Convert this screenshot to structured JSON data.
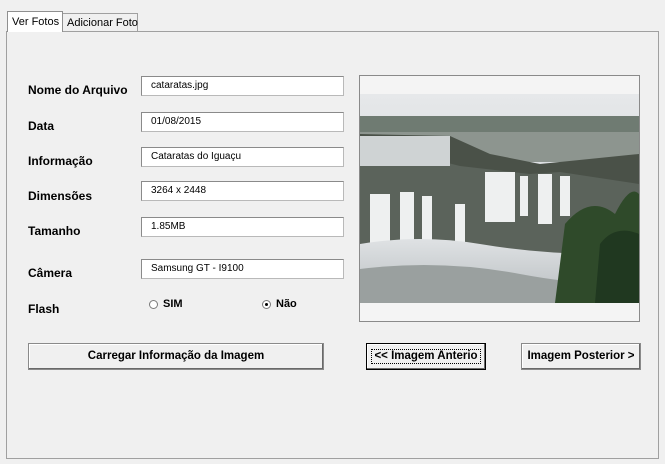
{
  "tabs": [
    {
      "label": "Ver Fotos",
      "active": true
    },
    {
      "label": "Adicionar Foto",
      "active": false
    }
  ],
  "form": {
    "nome_label": "Nome do Arquivo",
    "nome_value": "cataratas.jpg",
    "data_label": "Data",
    "data_value": "01/08/2015",
    "info_label": "Informação",
    "info_value": "Cataratas do Iguaçu",
    "dim_label": "Dimensões",
    "dim_value": "3264 x 2448",
    "tam_label": "Tamanho",
    "tam_value": "1.85MB",
    "cam_label": "Câmera",
    "cam_value": "Samsung GT - I9100",
    "flash_label": "Flash",
    "flash_options": [
      "SIM",
      "Não"
    ],
    "flash_selected": "Não"
  },
  "buttons": {
    "load": "Carregar Informação da Imagem",
    "prev": "<< Imagem Anterio",
    "next": "Imagem Posterior >"
  },
  "colors": {
    "background": "#f0f0f0",
    "field_bg": "#ffffff",
    "border": "#a0a0a0"
  }
}
